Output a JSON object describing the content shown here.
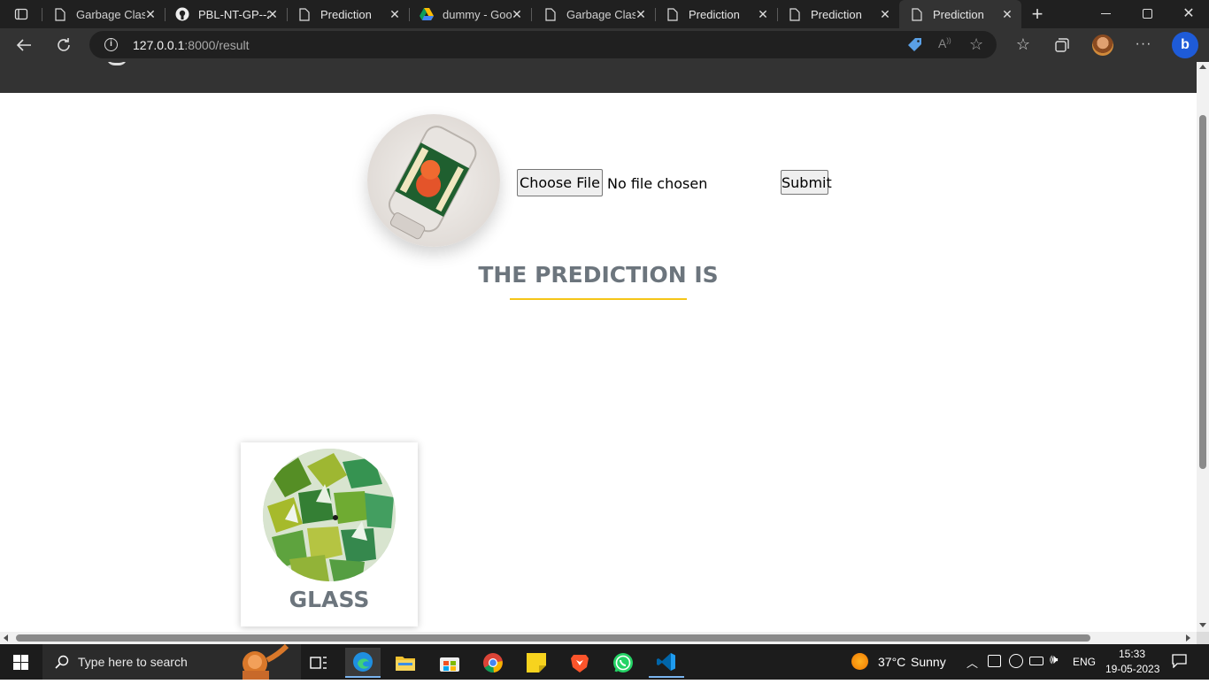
{
  "browser": {
    "tabs": [
      {
        "title": "Garbage Class",
        "icon": "page-icon"
      },
      {
        "title": "PBL-NT-GP--2",
        "icon": "github-icon"
      },
      {
        "title": "Prediction",
        "icon": "page-icon"
      },
      {
        "title": "dummy - Goo",
        "icon": "google-drive-icon"
      },
      {
        "title": "Garbage Class",
        "icon": "page-icon"
      },
      {
        "title": "Prediction",
        "icon": "page-icon"
      },
      {
        "title": "Prediction",
        "icon": "page-icon"
      },
      {
        "title": "Prediction",
        "icon": "page-icon",
        "active": true
      }
    ],
    "url_host": "127.0.0.1",
    "url_path": ":8000/result"
  },
  "page": {
    "file_button": "Choose File",
    "file_status": "No file chosen",
    "submit_label": "Submit",
    "prediction_heading": "THE PREDICTION IS",
    "result_label": "GLASS",
    "accent_color": "#f5c518",
    "heading_color": "#6c757d"
  },
  "taskbar": {
    "search_placeholder": "Type here to search",
    "temperature": "37°C",
    "weather": "Sunny",
    "language": "ENG",
    "time": "15:33",
    "date": "19-05-2023"
  }
}
